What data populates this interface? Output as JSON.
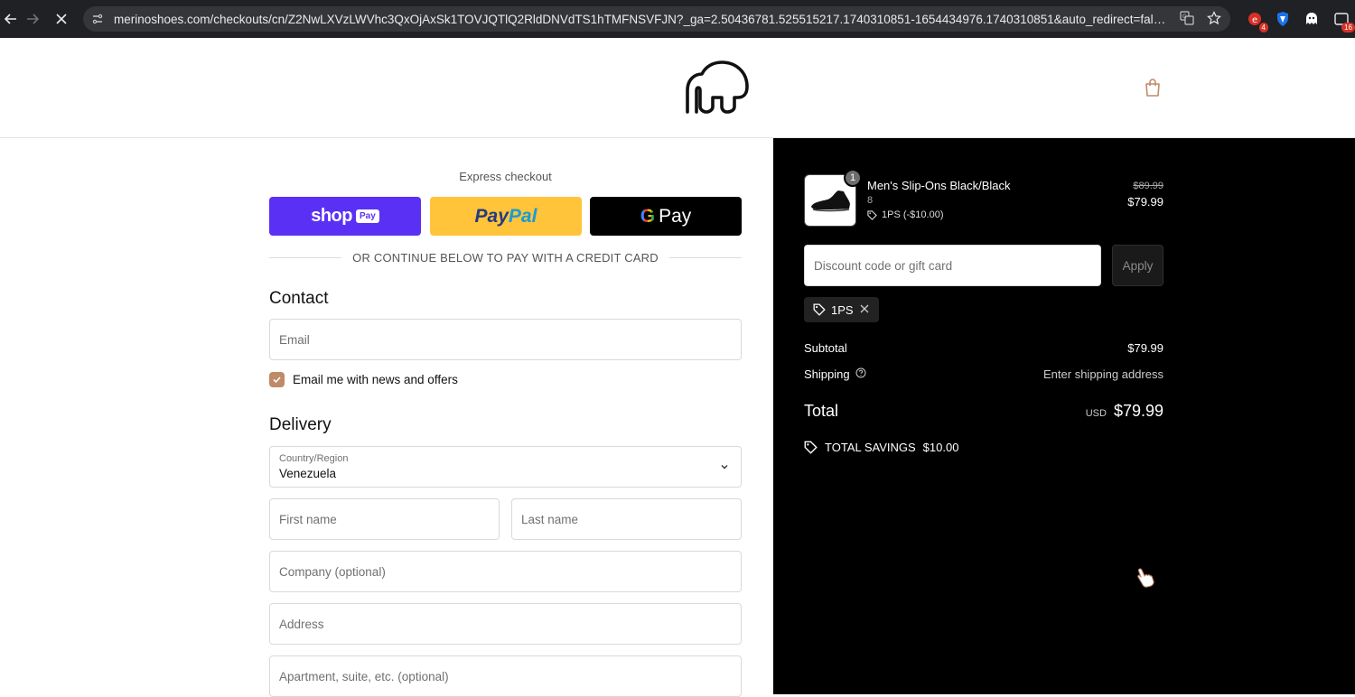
{
  "browser": {
    "url": "merinoshoes.com/checkouts/cn/Z2NwLXVzLWVhc3QxOjAxSk1TOVJQTlQ2RldDNVdTS1hTMFNSVFJN?_ga=2.50436781.525515217.1740310851-1654434976.1740310851&auto_redirect=false&edge_redirect=true...",
    "extensions": [
      {
        "icon": "extension-red-icon",
        "badge": "4"
      },
      {
        "icon": "shield-extension-icon",
        "badge": ""
      },
      {
        "icon": "ghostery-extension-icon",
        "badge": ""
      },
      {
        "icon": "tab-counter-extension-icon",
        "badge": "16"
      }
    ]
  },
  "header": {
    "logo": "merino-elephant-logo",
    "cart_icon": "shopping-bag-icon"
  },
  "express": {
    "title": "Express checkout",
    "shoppay_word": "shop",
    "shoppay_chip": "Pay",
    "paypal_part1": "Pay",
    "paypal_part2": "Pal",
    "gpay_g": "G",
    "gpay_word": "Pay",
    "divider_text": "OR CONTINUE BELOW TO PAY WITH A CREDIT CARD"
  },
  "contact": {
    "title": "Contact",
    "email_placeholder": "Email",
    "newsletter_label": "Email me with news and offers",
    "newsletter_checked": true
  },
  "delivery": {
    "title": "Delivery",
    "country_label": "Country/Region",
    "country_value": "Venezuela",
    "first_name_placeholder": "First name",
    "last_name_placeholder": "Last name",
    "company_placeholder": "Company (optional)",
    "address_placeholder": "Address",
    "apartment_placeholder": "Apartment, suite, etc. (optional)"
  },
  "summary": {
    "item": {
      "quantity": "1",
      "name": "Men's Slip-Ons Black/Black",
      "variant": "8",
      "discount": "1PS (-$10.00)",
      "price_original": "$89.99",
      "price_final": "$79.99"
    },
    "discount_placeholder": "Discount code or gift card",
    "apply_label": "Apply",
    "applied_code": "1PS",
    "subtotal_label": "Subtotal",
    "subtotal_value": "$79.99",
    "shipping_label": "Shipping",
    "shipping_value": "Enter shipping address",
    "total_label": "Total",
    "currency": "USD",
    "total_value": "$79.99",
    "savings_label": "TOTAL SAVINGS",
    "savings_value": "$10.00"
  },
  "colors": {
    "shoppay": "#5a31f4",
    "paypal": "#ffc439",
    "checkbox_accent": "#c08a68",
    "summary_bg": "#000000"
  }
}
